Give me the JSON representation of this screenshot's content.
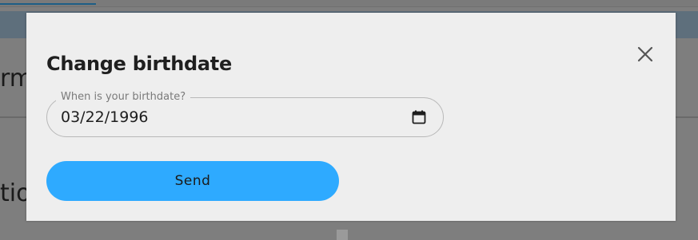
{
  "background": {
    "text_fragment_1": "rm",
    "text_fragment_2": "tio"
  },
  "dialog": {
    "title": "Change birthdate",
    "close_icon": "close-icon",
    "birthdate_field": {
      "label": "When is your birthdate?",
      "value": "03/22/1996",
      "icon": "calendar-icon"
    },
    "send_label": "Send",
    "colors": {
      "send_button": "#2eaaff",
      "dialog_background": "#eeeeee",
      "overlay": "#7e7e7e"
    }
  }
}
